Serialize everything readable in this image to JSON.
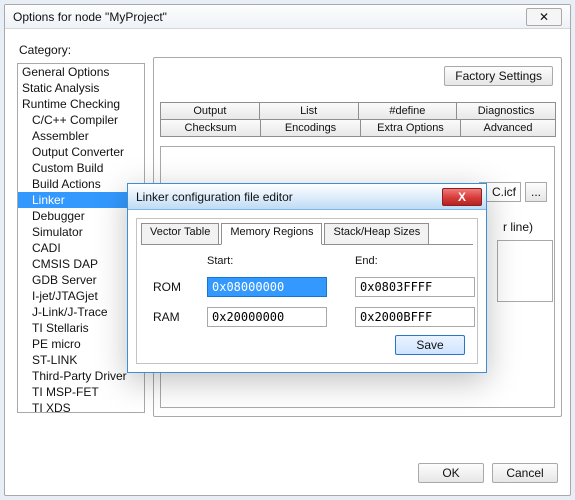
{
  "window": {
    "title": "Options for node \"MyProject\"",
    "close_glyph": "✕"
  },
  "category_label": "Category:",
  "categories": [
    {
      "label": "General Options",
      "indent": false,
      "selected": false
    },
    {
      "label": "Static Analysis",
      "indent": false,
      "selected": false
    },
    {
      "label": "Runtime Checking",
      "indent": false,
      "selected": false
    },
    {
      "label": "C/C++ Compiler",
      "indent": true,
      "selected": false
    },
    {
      "label": "Assembler",
      "indent": true,
      "selected": false
    },
    {
      "label": "Output Converter",
      "indent": true,
      "selected": false
    },
    {
      "label": "Custom Build",
      "indent": true,
      "selected": false
    },
    {
      "label": "Build Actions",
      "indent": true,
      "selected": false
    },
    {
      "label": "Linker",
      "indent": true,
      "selected": true
    },
    {
      "label": "Debugger",
      "indent": true,
      "selected": false
    },
    {
      "label": "Simulator",
      "indent": true,
      "selected": false
    },
    {
      "label": "CADI",
      "indent": true,
      "selected": false
    },
    {
      "label": "CMSIS DAP",
      "indent": true,
      "selected": false
    },
    {
      "label": "GDB Server",
      "indent": true,
      "selected": false
    },
    {
      "label": "I-jet/JTAGjet",
      "indent": true,
      "selected": false
    },
    {
      "label": "J-Link/J-Trace",
      "indent": true,
      "selected": false
    },
    {
      "label": "TI Stellaris",
      "indent": true,
      "selected": false
    },
    {
      "label": "PE micro",
      "indent": true,
      "selected": false
    },
    {
      "label": "ST-LINK",
      "indent": true,
      "selected": false
    },
    {
      "label": "Third-Party Driver",
      "indent": true,
      "selected": false
    },
    {
      "label": "TI MSP-FET",
      "indent": true,
      "selected": false
    },
    {
      "label": "TI XDS",
      "indent": true,
      "selected": false
    }
  ],
  "right_panel": {
    "factory_btn": "Factory Settings",
    "tabs_row1": [
      "Output",
      "List",
      "#define",
      "Diagnostics"
    ],
    "tabs_row2": [
      "Checksum",
      "Encodings",
      "Extra Options"
    ],
    "tabs_row3_right": "Advanced",
    "visible_path_suffix": "C.icf",
    "browse_btn": "...",
    "per_line_label": "r line)"
  },
  "modal": {
    "title": "Linker configuration file editor",
    "close_glyph": "X",
    "tabs": [
      {
        "label": "Vector Table",
        "active": false
      },
      {
        "label": "Memory Regions",
        "active": true
      },
      {
        "label": "Stack/Heap Sizes",
        "active": false
      }
    ],
    "col_headers": {
      "start": "Start:",
      "end": "End:"
    },
    "rows": [
      {
        "name": "ROM",
        "start": "0x08000000",
        "start_selected": true,
        "end": "0x0803FFFF"
      },
      {
        "name": "RAM",
        "start": "0x20000000",
        "start_selected": false,
        "end": "0x2000BFFF"
      }
    ],
    "save_btn": "Save"
  },
  "buttons": {
    "ok": "OK",
    "cancel": "Cancel"
  }
}
